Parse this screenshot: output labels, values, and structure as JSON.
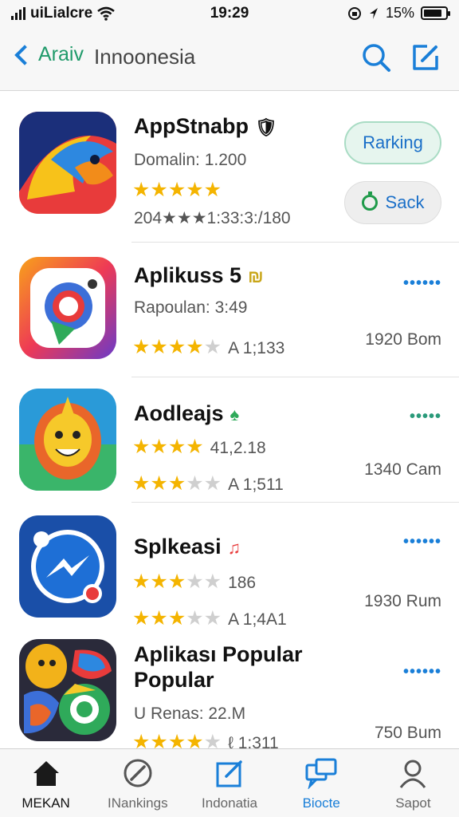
{
  "status_bar": {
    "carrier": "uiLialcre",
    "time": "19:29",
    "battery": "15%",
    "battery_level": 0.85
  },
  "nav": {
    "back_label": "Araiv",
    "title": "Innoonesia",
    "search_icon": "search-icon",
    "edit_icon": "compose-icon"
  },
  "apps": [
    {
      "name": "AppStnabp",
      "meta": "Domalin:  1.200",
      "rating": 5,
      "rating_text": "204★★★1:33:3:/180",
      "rank_button": "Rarking",
      "sack_button": "Sack"
    },
    {
      "name": "Aplikuss 5",
      "meta": "Rapoulan:  3:49",
      "rating": 4,
      "count": "A 1;133",
      "size": "1920 Bom"
    },
    {
      "name": "Aodleajs",
      "rating_a": 4,
      "count_a": "41,2.18",
      "rating": 3,
      "count": "A 1;511",
      "size": "1340 Cam"
    },
    {
      "name": "Splkeasi",
      "rating_a": 3,
      "count_a": "186",
      "rating": 3,
      "count": "A 1;4A1",
      "size": "1930 Rum"
    },
    {
      "name": "Aplikası Popular",
      "name2": "Popular",
      "meta": "U  Renas: 22.M",
      "rating": 4,
      "count": "ℓ 1:311",
      "size": "750 Bum"
    }
  ],
  "tabs": [
    {
      "label": "MEKAN",
      "icon": "home-icon"
    },
    {
      "label": "INankings",
      "icon": "compass-icon"
    },
    {
      "label": "Indonatia",
      "icon": "edit-square-icon"
    },
    {
      "label": "Biocte",
      "icon": "chat-bubbles-icon"
    },
    {
      "label": "Sapot",
      "icon": "person-icon"
    }
  ],
  "colors": {
    "accent": "#1a7fd8",
    "star": "#f4b400",
    "green": "#1f9a6a"
  }
}
